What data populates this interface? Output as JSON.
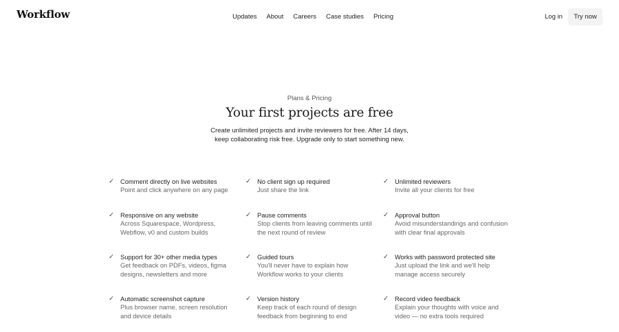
{
  "header": {
    "logo": "Workflow",
    "nav": [
      "Updates",
      "About",
      "Careers",
      "Case studies",
      "Pricing"
    ],
    "login": "Log in",
    "cta": "Try now"
  },
  "hero": {
    "eyebrow": "Plans & Pricing",
    "title": "Your first projects are free",
    "subtitle_line1": "Create unlimited projects and invite reviewers for free. After 14 days,",
    "subtitle_line2": "keep collaborating risk free. Upgrade only to start something new."
  },
  "icons": {
    "check": "check-icon"
  },
  "features": [
    {
      "title": "Comment directly on live websites",
      "desc": [
        "Point and click anywhere on any page"
      ]
    },
    {
      "title": "No client sign up required",
      "desc": [
        "Just share the link"
      ]
    },
    {
      "title": "Unlimited reviewers",
      "desc": [
        "Invite all your clients for free"
      ]
    },
    {
      "title": "Responsive on any website",
      "desc": [
        "Across Squarespace, Wordpress,",
        "Webflow, v0 and custom builds"
      ]
    },
    {
      "title": "Pause comments",
      "desc": [
        "Stop clients from leaving comments until",
        "the next round of review"
      ]
    },
    {
      "title": "Approval button",
      "desc": [
        "Avoid misunderstandings and confusion",
        "with clear final approvals"
      ]
    },
    {
      "title": "Support for 30+ other media types",
      "desc": [
        "Get feedback on PDFs, videos, figma",
        "designs, newsletters and more"
      ]
    },
    {
      "title": "Guided tours",
      "desc": [
        "You'll never have to explain how",
        "Workflow works to your clients"
      ]
    },
    {
      "title": "Works with password protected site",
      "desc": [
        "Just upload the link and we'll help",
        "manage access securely"
      ]
    },
    {
      "title": "Automatic screenshot capture",
      "desc": [
        "Plus browser name, screen resolution",
        "and device details"
      ]
    },
    {
      "title": "Version history",
      "desc": [
        "Keep track of each round of design",
        "feedback from beginning to end"
      ]
    },
    {
      "title": "Record video feedback",
      "desc": [
        "Explain your thoughts with voice and",
        "video — no extra tools required"
      ]
    }
  ]
}
